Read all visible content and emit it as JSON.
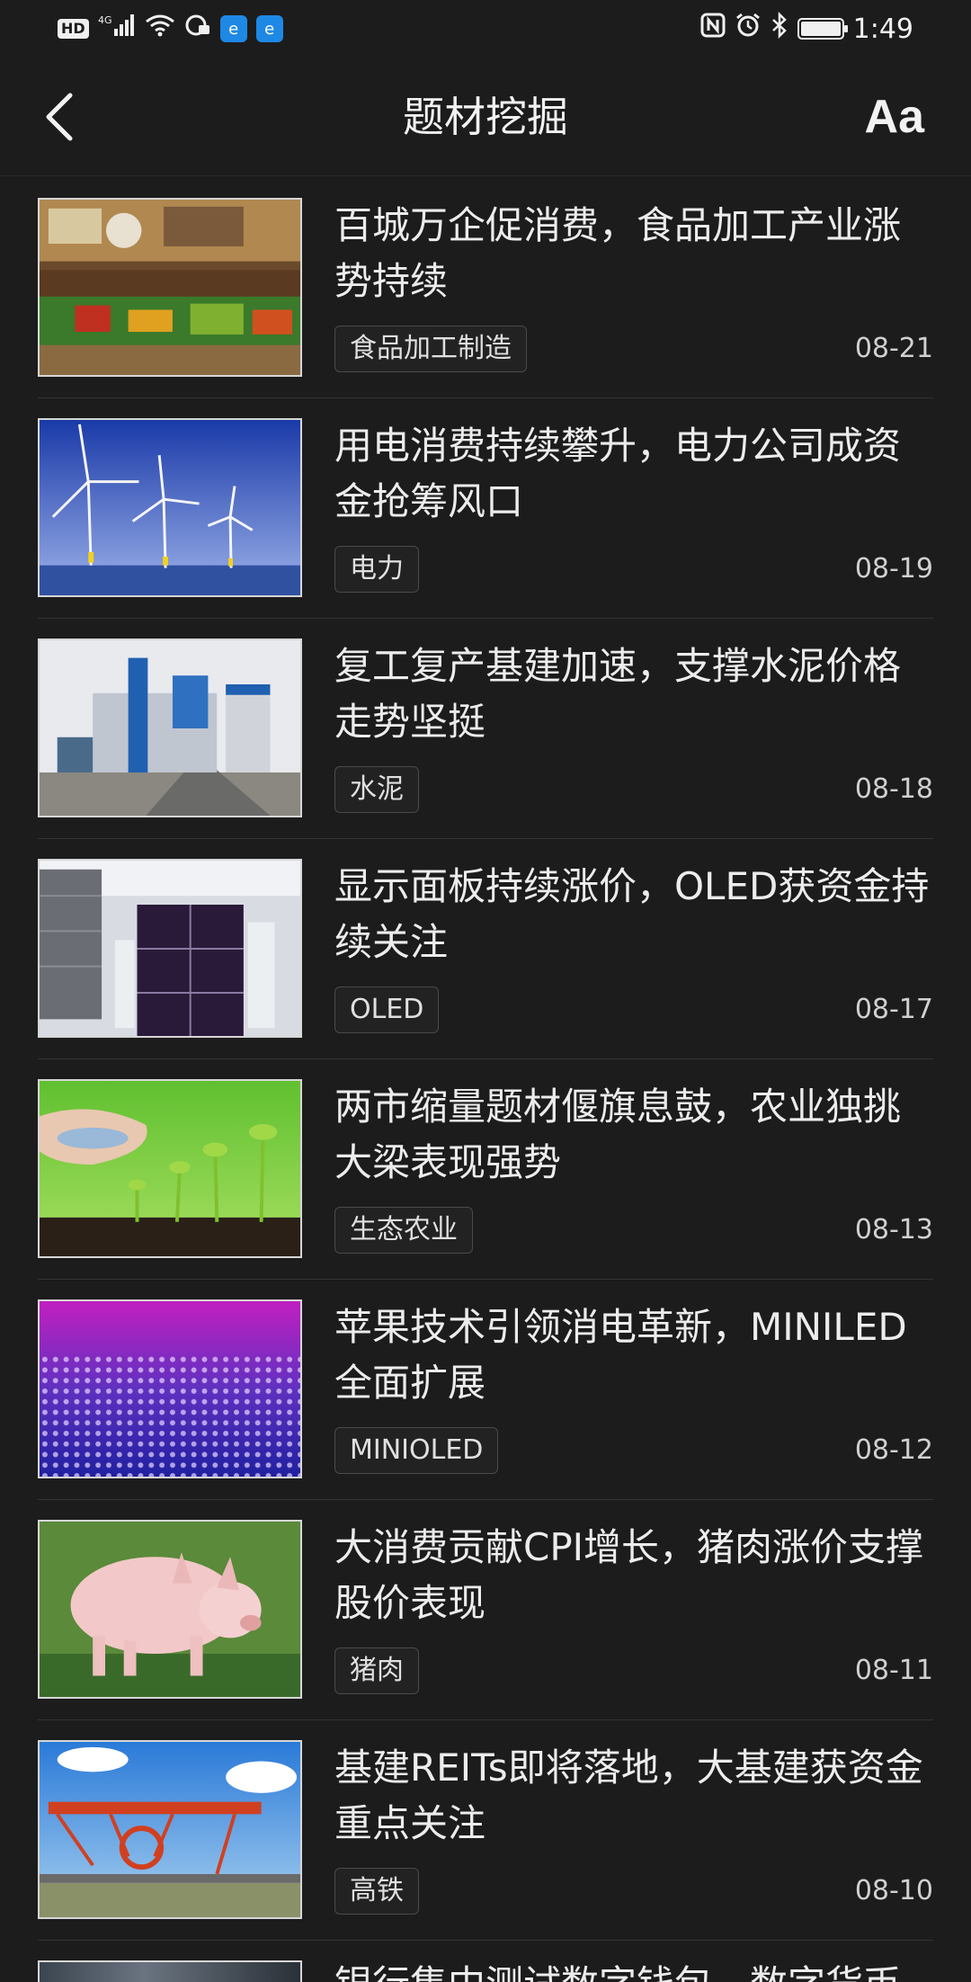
{
  "status_bar": {
    "hd": "HD",
    "network": "4G",
    "time": "1:49",
    "app_badge": "e"
  },
  "header": {
    "title": "题材挖掘",
    "font_button": "Aa"
  },
  "news": [
    {
      "title": "百城万企促消费，食品加工产业涨势持续",
      "tag": "食品加工制造",
      "date": "08-21",
      "image": "supermarket"
    },
    {
      "title": "用电消费持续攀升，电力公司成资金抢筹风口",
      "tag": "电力",
      "date": "08-19",
      "image": "wind-turbines"
    },
    {
      "title": "复工复产基建加速，支撑水泥价格走势坚挺",
      "tag": "水泥",
      "date": "08-18",
      "image": "cement-plant"
    },
    {
      "title": "显示面板持续涨价，OLED获资金持续关注",
      "tag": "OLED",
      "date": "08-17",
      "image": "display-factory"
    },
    {
      "title": "两市缩量题材偃旗息鼓，农业独挑大梁表现强势",
      "tag": "生态农业",
      "date": "08-13",
      "image": "seedlings"
    },
    {
      "title": "苹果技术引领消电革新，MINILED全面扩展",
      "tag": "MINIOLED",
      "date": "08-12",
      "image": "led-dots"
    },
    {
      "title": "大消费贡献CPI增长，猪肉涨价支撑股价表现",
      "tag": "猪肉",
      "date": "08-11",
      "image": "pig"
    },
    {
      "title": "基建REITs即将落地，大基建获资金重点关注",
      "tag": "高铁",
      "date": "08-10",
      "image": "bridge-crane"
    }
  ],
  "partial_item": {
    "title": "银行集中测试数字钱包，数字货币"
  }
}
